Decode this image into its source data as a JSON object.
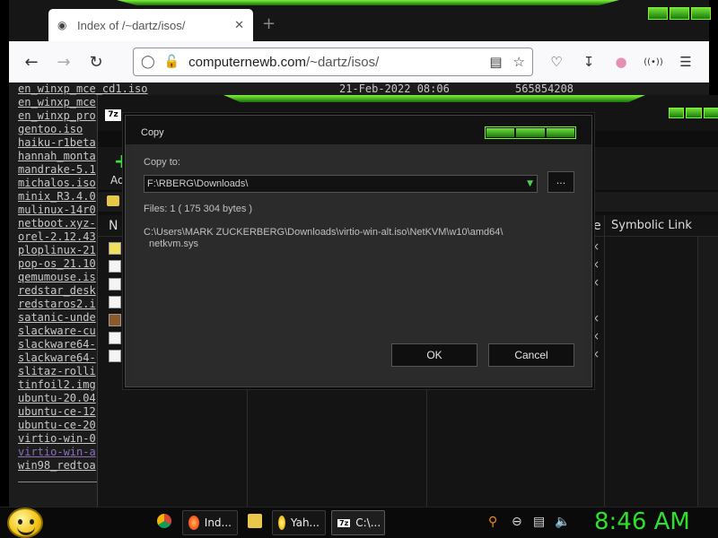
{
  "browser": {
    "tab_title": "Index of /~dartz/isos/",
    "url_domain": "computernewb.com",
    "url_path": "/~dartz/isos/"
  },
  "listing": {
    "first_row": {
      "name": "en_winxp_mce_cd1.iso",
      "date": "21-Feb-2022 08:06",
      "size": "565854208"
    },
    "rows": [
      "en_winxp_mce",
      "en_winxp_pro",
      "gentoo.iso",
      "haiku-r1beta",
      "hannah_monta",
      "mandrake-5.1",
      "michalos.iso",
      "minix_R3.4.0",
      "mulinux-14r0",
      "netboot.xyz-",
      "orel-2.12.43",
      "ploplinux-21",
      "pop-os_21.10",
      "qemumouse.is",
      "redstar_desk",
      "redstaros2.i",
      "satanic-unde",
      "slackware-cu",
      "slackware64-",
      "slackware64-",
      "slitaz-rolli",
      "tinfoil2.img",
      "ubuntu-20.04",
      "ubuntu-ce-12",
      "ubuntu-ce-20",
      "virtio-win-0",
      "virtio-win-a",
      "win98_redtoa"
    ],
    "visited_index": 26
  },
  "zip": {
    "logo": "7z",
    "add_label": "Ad",
    "col_name": "N",
    "col_attr": "e",
    "col_symlink": "Symbolic Link",
    "x_marks": [
      "×",
      "×",
      "×",
      "×",
      "×",
      "×"
    ]
  },
  "dialog": {
    "title": "Copy",
    "copy_to_label": "Copy to:",
    "copy_to_value": "F:\\RBERG\\Downloads\\",
    "browse_label": "...",
    "files_info": "Files: 1    ( 175 304 bytes )",
    "source_line1": "C:\\Users\\MARK ZUCKERBERG\\Downloads\\virtio-win-alt.iso\\NetKVM\\w10\\amd64\\",
    "source_line2": "netkvm.sys",
    "ok_label": "OK",
    "cancel_label": "Cancel"
  },
  "taskbar": {
    "items": [
      {
        "label": "Ind..."
      },
      {
        "label": "Yah..."
      },
      {
        "label": "C:\\..."
      }
    ],
    "clock": "8:46 AM"
  },
  "colors": {
    "accent_green": "#7cf23a",
    "clock_green": "#2ee02e"
  }
}
